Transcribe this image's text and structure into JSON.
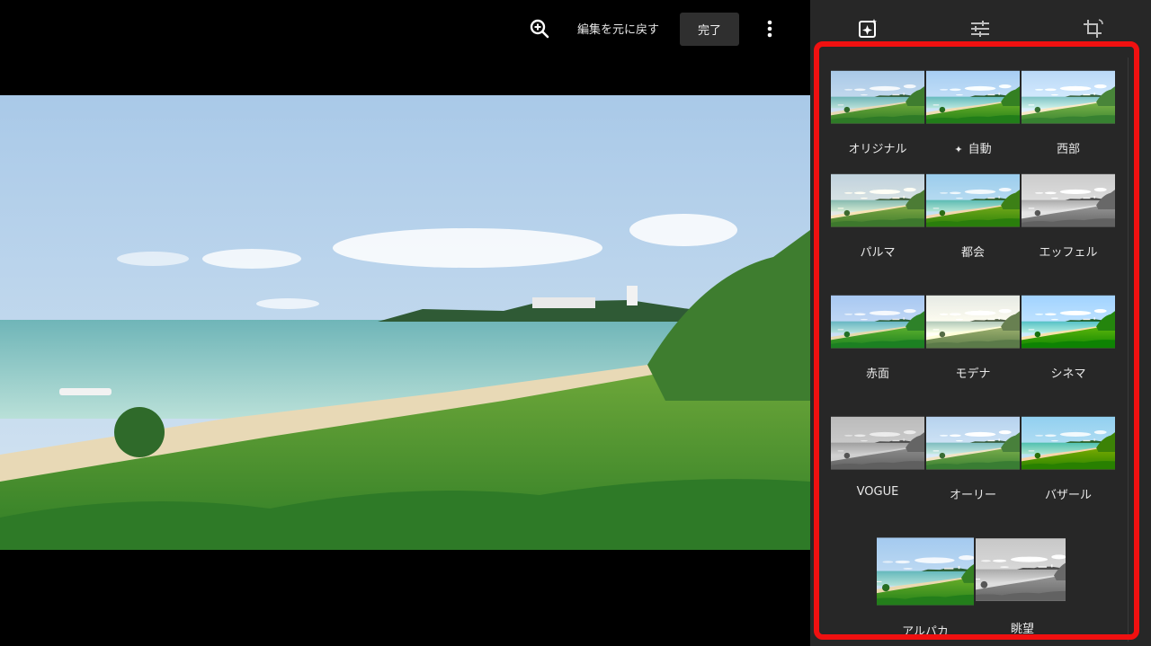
{
  "toolbar": {
    "zoom_icon": "zoom-in-icon",
    "undo_label": "編集を元に戻す",
    "done_label": "完了",
    "more_icon": "more-vert-icon"
  },
  "panel": {
    "tabs": [
      {
        "icon": "filters-icon",
        "active": true
      },
      {
        "icon": "adjust-sliders-icon",
        "active": false
      },
      {
        "icon": "crop-rotate-icon",
        "active": false
      }
    ],
    "highlight_color": "#f01010"
  },
  "filters": [
    {
      "label": "オリジナル"
    },
    {
      "label": "自動",
      "icon": "sparkle-icon"
    },
    {
      "label": "西部"
    },
    {
      "label": "パルマ"
    },
    {
      "label": "都会"
    },
    {
      "label": "エッフェル"
    },
    {
      "label": "赤面"
    },
    {
      "label": "モデナ"
    },
    {
      "label": "シネマ"
    },
    {
      "label": "VOGUE"
    },
    {
      "label": "オーリー"
    },
    {
      "label": "バザール"
    },
    {
      "label": "アルパカ"
    },
    {
      "label": "眺望"
    }
  ]
}
